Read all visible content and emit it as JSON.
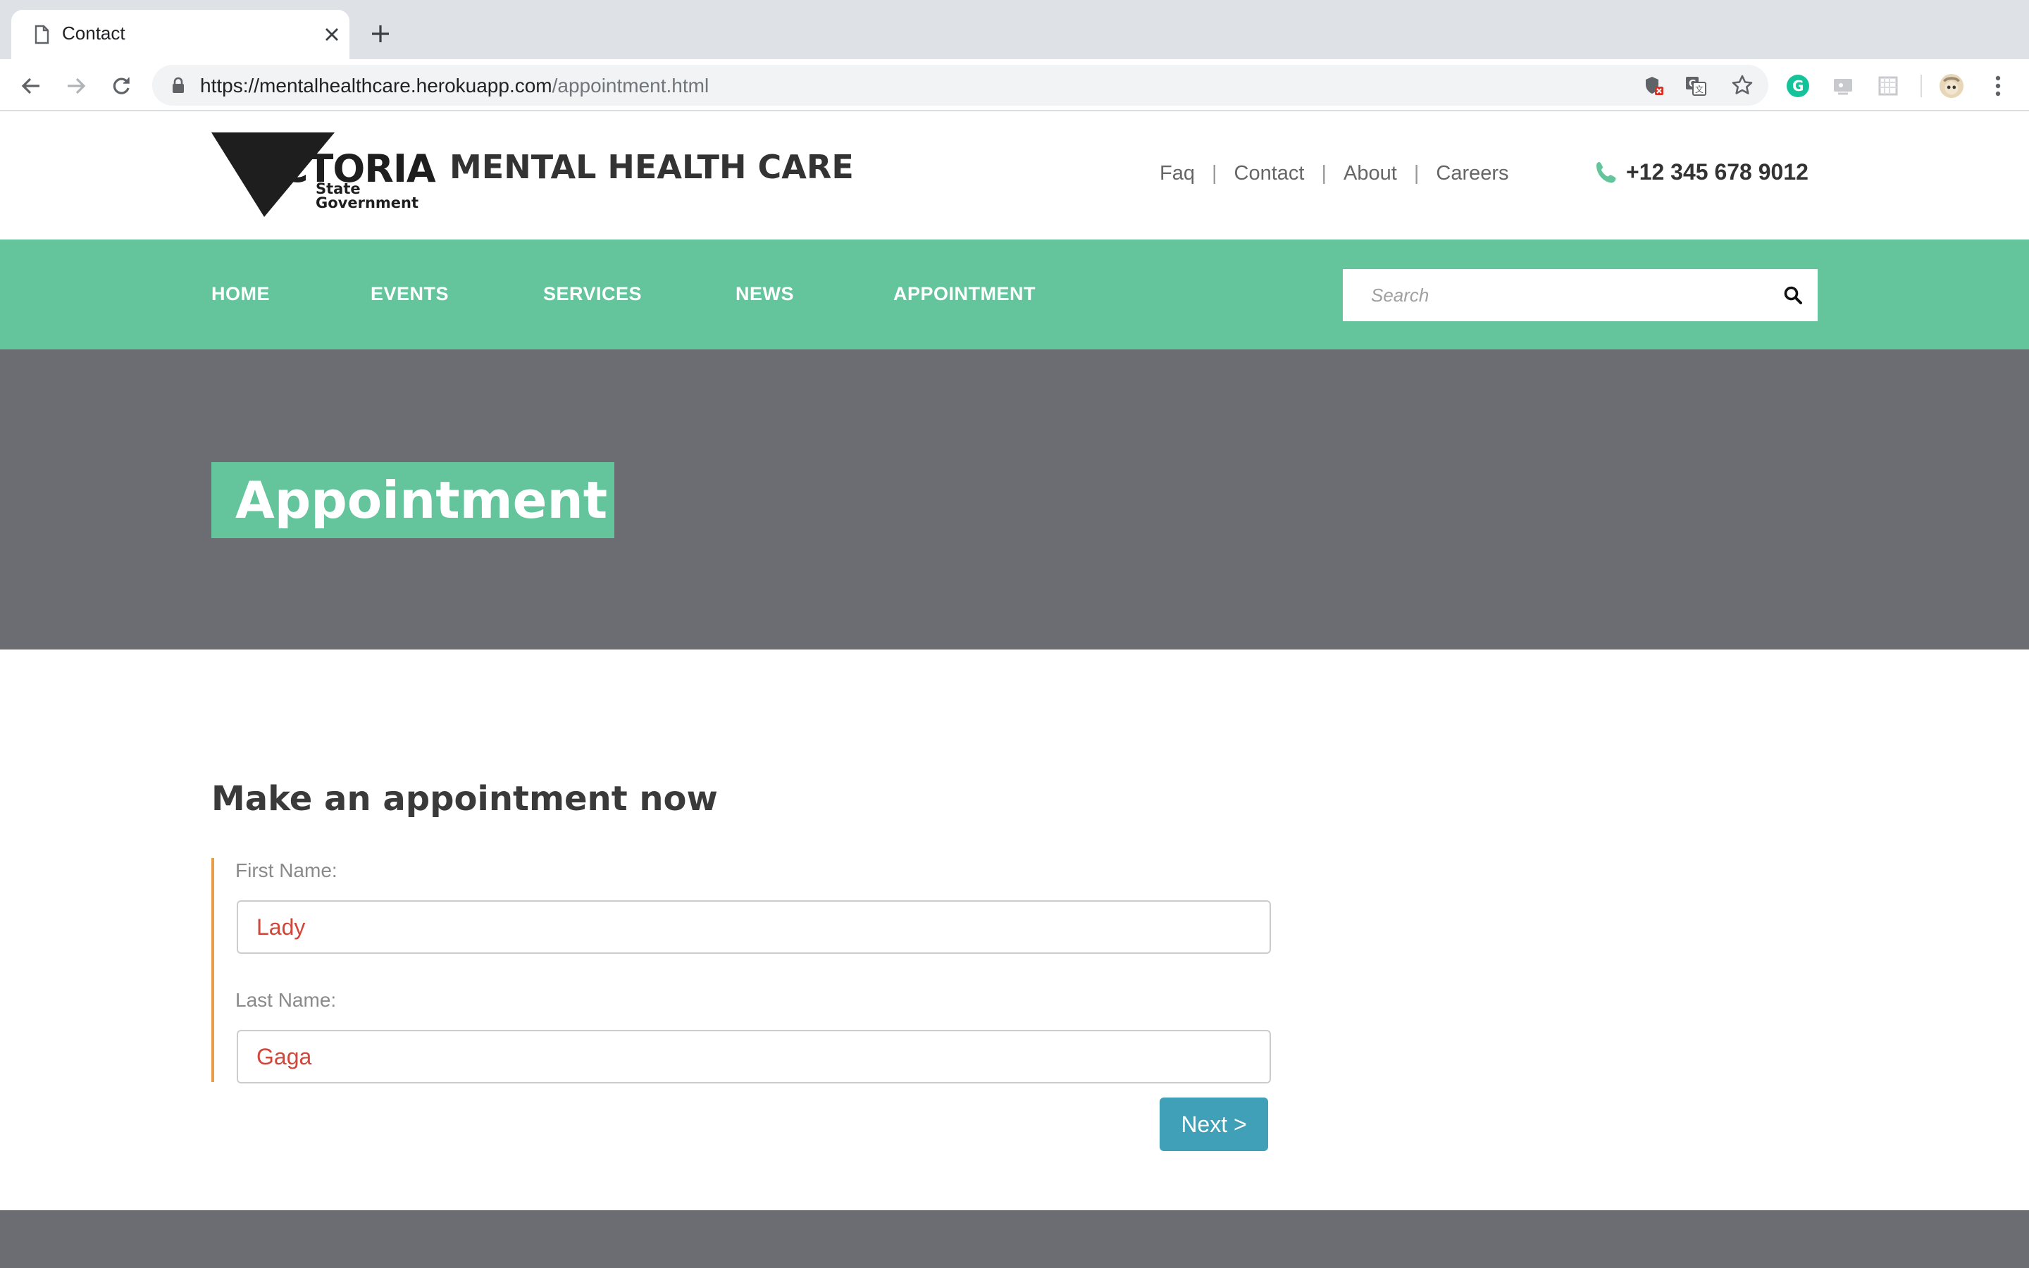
{
  "browser": {
    "tab_title": "Contact",
    "url_host": "https://mentalhealthcare.herokuapp.com",
    "url_path": "/appointment.html"
  },
  "site": {
    "logo_word": "VICTORIA",
    "logo_sub_line1": "State",
    "logo_sub_line2": "Government",
    "title": "MENTAL HEALTH CARE",
    "top_links": [
      "Faq",
      "Contact",
      "About",
      "Careers"
    ],
    "top_link_separator": "|",
    "phone": "+12 345 678 9012"
  },
  "nav": {
    "items": [
      "HOME",
      "EVENTS",
      "SERVICES",
      "NEWS",
      "APPOINTMENT"
    ],
    "search_placeholder": "Search"
  },
  "hero": {
    "title": "Appointment"
  },
  "form": {
    "heading": "Make an appointment now",
    "first_name_label": "First Name:",
    "first_name_value": "Lady",
    "last_name_label": "Last Name:",
    "last_name_value": "Gaga",
    "next_label": "Next >"
  },
  "colors": {
    "brand_green": "#64c49c",
    "hero_gray": "#6b6d72",
    "accent_orange": "#e89d4a",
    "button_blue": "#3fa0b8",
    "input_text_red": "#d0473a"
  }
}
